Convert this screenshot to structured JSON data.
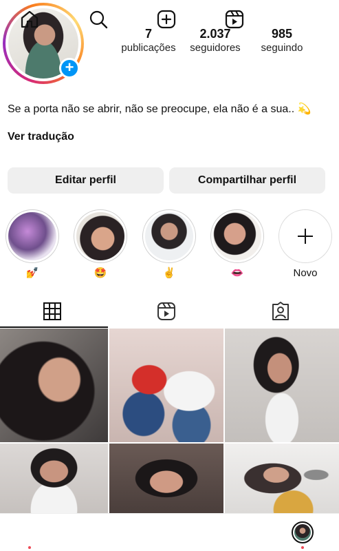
{
  "profile": {
    "stats": [
      {
        "value": "7",
        "label": "publicações"
      },
      {
        "value": "2.037",
        "label": "seguidores"
      },
      {
        "value": "985",
        "label": "seguindo"
      }
    ],
    "bio": "Se a porta não se abrir, não se preocupe, ela não é a sua.. 💫",
    "translate_label": "Ver tradução"
  },
  "actions": {
    "edit_label": "Editar perfil",
    "share_label": "Compartilhar perfil"
  },
  "highlights": [
    {
      "caption": "💅"
    },
    {
      "caption": "🤩"
    },
    {
      "caption": "✌️"
    },
    {
      "caption": "👄"
    },
    {
      "caption": "Novo"
    }
  ],
  "tabs": [
    "grid-icon",
    "reels-icon",
    "tagged-icon"
  ],
  "nav": [
    "home-icon",
    "search-icon",
    "create-icon",
    "reels-icon",
    "profile-avatar"
  ],
  "colors": {
    "accent": "#0095f6",
    "button_bg": "#efefef",
    "notification_dot": "#ed4956"
  }
}
